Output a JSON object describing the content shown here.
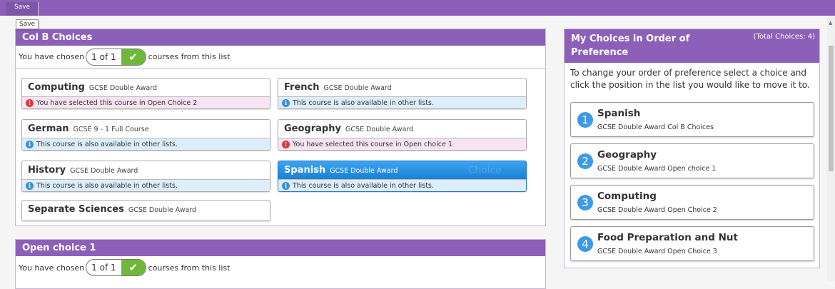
{
  "toolbar": {
    "save_label": "Save",
    "save_tooltip": "Save"
  },
  "colb": {
    "title": "Col B Choices",
    "chosen_prefix": "You have chosen",
    "chosen_count": "1 of 1",
    "chosen_suffix": "courses from this list",
    "courses": [
      {
        "name": "Computing",
        "type": "GCSE Double Award",
        "msg": "You have selected this course in Open Choice 2",
        "msg_kind": "warn"
      },
      {
        "name": "French",
        "type": "GCSE Double Award",
        "msg": "This course is also available in other lists.",
        "msg_kind": "info"
      },
      {
        "name": "German",
        "type": "GCSE 9 - 1 Full Course",
        "msg": "This course is also available in other lists.",
        "msg_kind": "info"
      },
      {
        "name": "Geography",
        "type": "GCSE Double Award",
        "msg": "You have selected this course in Open choice 1",
        "msg_kind": "warn"
      },
      {
        "name": "History",
        "type": "GCSE Double Award",
        "msg": "This course is also available in other lists.",
        "msg_kind": "info"
      },
      {
        "name": "Spanish",
        "type": "GCSE Double Award",
        "msg": "This course is also available in other lists.",
        "msg_kind": "info",
        "selected": true,
        "watermark": "Choice"
      },
      {
        "name": "Separate Sciences",
        "type": "GCSE Double Award"
      }
    ]
  },
  "open1": {
    "title": "Open choice 1",
    "chosen_prefix": "You have chosen",
    "chosen_count": "1 of 1",
    "chosen_suffix": "courses from this list"
  },
  "preferences": {
    "title": "My Choices in Order of Preference",
    "total": "(Total Choices: 4)",
    "intro": "To change your order of preference select a choice and click the position in the list you would like to move it to.",
    "items": [
      {
        "rank": "1",
        "name": "Spanish",
        "sub": "GCSE Double Award Col B Choices"
      },
      {
        "rank": "2",
        "name": "Geography",
        "sub": "GCSE Double Award Open choice 1"
      },
      {
        "rank": "3",
        "name": "Computing",
        "sub": "GCSE Double Award Open Choice 2"
      },
      {
        "rank": "4",
        "name": "Food Preparation and Nut",
        "sub": "GCSE Double Award Open Choice 3"
      }
    ]
  },
  "icons": {
    "check": "check-icon",
    "info": "info-icon",
    "warn": "warning-icon"
  },
  "colors": {
    "purple": "#8c60b8",
    "blue_selected": "#1b80d6",
    "green": "#6fb83a",
    "info_bg": "#ddeefa",
    "warn_bg": "#f6e4f2"
  }
}
